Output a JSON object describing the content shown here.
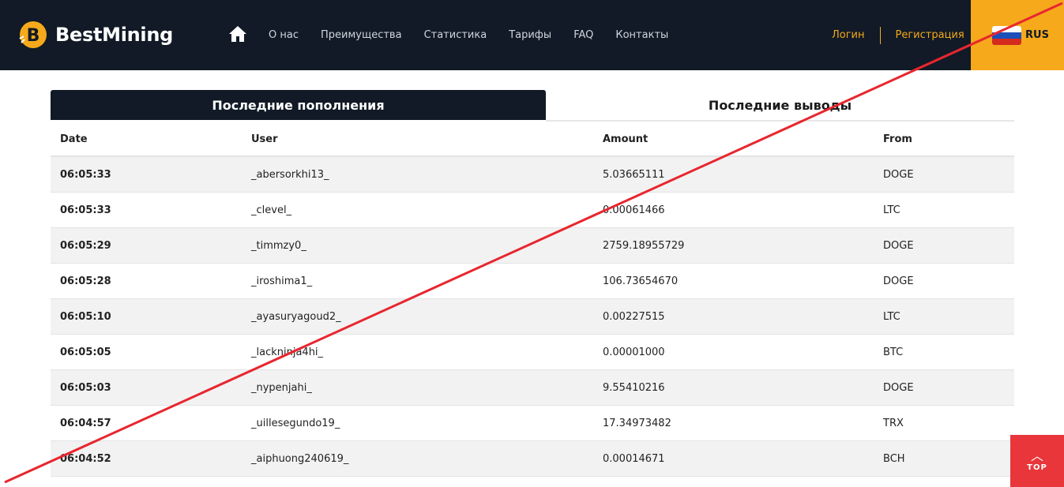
{
  "brand": {
    "name": "BestMining",
    "logo_icon": "bitcoin-b-icon"
  },
  "nav": {
    "home_icon": "home-icon",
    "items": [
      "О нас",
      "Преимущества",
      "Статистика",
      "Тарифы",
      "FAQ",
      "Контакты"
    ]
  },
  "auth": {
    "login": "Логин",
    "register": "Регистрация"
  },
  "lang": {
    "label": "RUS",
    "flag_icon": "russia-flag-icon"
  },
  "tabs": {
    "active": "Последние пополнения",
    "inactive": "Последние выводы"
  },
  "table": {
    "headers": [
      "Date",
      "User",
      "Amount",
      "From"
    ],
    "rows": [
      [
        "06:05:33",
        "_abersorkhi13_",
        "5.03665111",
        "DOGE"
      ],
      [
        "06:05:33",
        "_clevel_",
        "0.00061466",
        "LTC"
      ],
      [
        "06:05:29",
        "_timmzy0_",
        "2759.18955729",
        "DOGE"
      ],
      [
        "06:05:28",
        "_iroshima1_",
        "106.73654670",
        "DOGE"
      ],
      [
        "06:05:10",
        "_ayasuryagoud2_",
        "0.00227515",
        "LTC"
      ],
      [
        "06:05:05",
        "_lackninja4hi_",
        "0.00001000",
        "BTC"
      ],
      [
        "06:05:03",
        "_nypenjahi_",
        "9.55410216",
        "DOGE"
      ],
      [
        "06:04:57",
        "_uillesegundo19_",
        "17.34973482",
        "TRX"
      ],
      [
        "06:04:52",
        "_aiphuong240619_",
        "0.00014671",
        "BCH"
      ]
    ]
  },
  "back_to_top": {
    "label": "TOP",
    "icon": "chevron-up-icon"
  },
  "colors": {
    "header_bg": "#111a26",
    "accent": "#f5a91b",
    "strike_line": "#e8262e",
    "top_button": "#e8363a"
  }
}
